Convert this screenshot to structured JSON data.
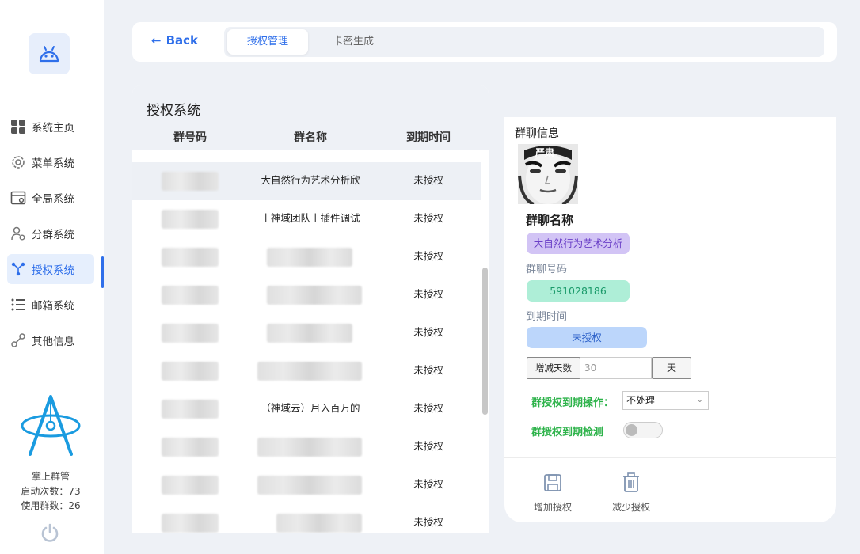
{
  "sidebar": {
    "items": [
      {
        "label": "系统主页",
        "icon": "grid-icon",
        "active": false
      },
      {
        "label": "菜单系统",
        "icon": "gear-icon",
        "active": false
      },
      {
        "label": "全局系统",
        "icon": "window-icon",
        "active": false
      },
      {
        "label": "分群系统",
        "icon": "user-settings-icon",
        "active": false
      },
      {
        "label": "授权系统",
        "icon": "network-icon",
        "active": true
      },
      {
        "label": "邮箱系统",
        "icon": "list-icon",
        "active": false
      },
      {
        "label": "其他信息",
        "icon": "link-icon",
        "active": false
      }
    ],
    "brand": "掌上群管",
    "stat_launch": "启动次数：73",
    "stat_groups": "使用群数：26"
  },
  "topbar": {
    "back_label": "Back",
    "tabs": [
      {
        "label": "授权管理",
        "active": true
      },
      {
        "label": "卡密生成",
        "active": false
      }
    ]
  },
  "table": {
    "title": "授权系统",
    "columns": [
      "群号码",
      "群名称",
      "到期时间"
    ],
    "rows": [
      {
        "name": "大自然行为艺术分析欣",
        "expire": "未授权",
        "selected": true
      },
      {
        "name": "丨神域团队丨插件调试",
        "expire": "未授权"
      },
      {
        "name": "",
        "expire": "未授权"
      },
      {
        "name": "",
        "expire": "未授权"
      },
      {
        "name": "",
        "expire": "未授权"
      },
      {
        "name": "",
        "expire": "未授权"
      },
      {
        "name": "（神域云）月入百万的",
        "expire": "未授权"
      },
      {
        "name": "",
        "expire": "未授权"
      },
      {
        "name": "",
        "expire": "未授权"
      },
      {
        "name": "",
        "expire": "未授权"
      }
    ]
  },
  "detail": {
    "section_title": "群聊信息",
    "avatar_text": "严肃",
    "name_title": "群聊名称",
    "name_value": "大自然行为艺术分析",
    "number_label": "群聊号码",
    "number_value": "591028186",
    "expire_label": "到期时间",
    "expire_value": "未授权",
    "days_button": "增减天数",
    "days_placeholder": "30",
    "days_unit": "天",
    "expire_action_label": "群授权到期操作：",
    "expire_action_value": "不处理",
    "expire_check_label": "群授权到期检测",
    "expire_check_on": false,
    "add_label": "增加授权",
    "remove_label": "减少授权"
  },
  "colors": {
    "accent": "#2f6fea",
    "green": "#2eb34b",
    "purple_pill": "#d2c4f5",
    "teal_pill": "#aeeed7",
    "blue_pill": "#bcd6fb"
  }
}
